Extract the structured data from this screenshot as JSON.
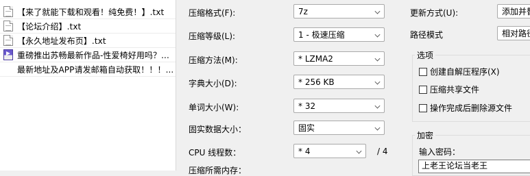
{
  "files": [
    {
      "name": "【来了就能下载和观看！纯免费！】.txt",
      "icon": "txt-file-icon"
    },
    {
      "name": "【论坛介绍】.txt",
      "icon": "txt-file-icon"
    },
    {
      "name": "【永久地址发布页】.txt",
      "icon": "txt-file-icon"
    },
    {
      "name": "重磅推出苏畅最新作品-性爱椅好用吗？...",
      "icon": "mp4-file-icon"
    },
    {
      "name": "最新地址及APP请发邮箱自动获取！！！...",
      "icon": "blank-file-icon"
    }
  ],
  "form": {
    "format_label": "压缩格式(F):",
    "format_value": "7z",
    "level_label": "压缩等级(L):",
    "level_value": "1 - 极速压缩",
    "method_label": "压缩方法(M):",
    "method_value": "* LZMA2",
    "dict_label": "字典大小(D):",
    "dict_value": "* 256 KB",
    "word_label": "单词大小(W):",
    "word_value": "* 32",
    "solid_label": "固实数据大小：",
    "solid_value": "固实",
    "cpu_label": "CPU 线程数：",
    "cpu_value": "* 4",
    "cpu_total": "/ 4",
    "memory_label": "压缩所需内存："
  },
  "right": {
    "update_label": "更新方式(U):",
    "update_value": "添加并替",
    "path_label": "路径模式",
    "path_value": "相对路径",
    "options_title": "选项",
    "opt_sfx": "创建自解压程序(X)",
    "opt_shared": "压缩共享文件",
    "opt_delete": "操作完成后删除源文件",
    "encrypt_title": "加密",
    "password_label": "输入密码：",
    "password_value": "上老王论坛当老王"
  }
}
